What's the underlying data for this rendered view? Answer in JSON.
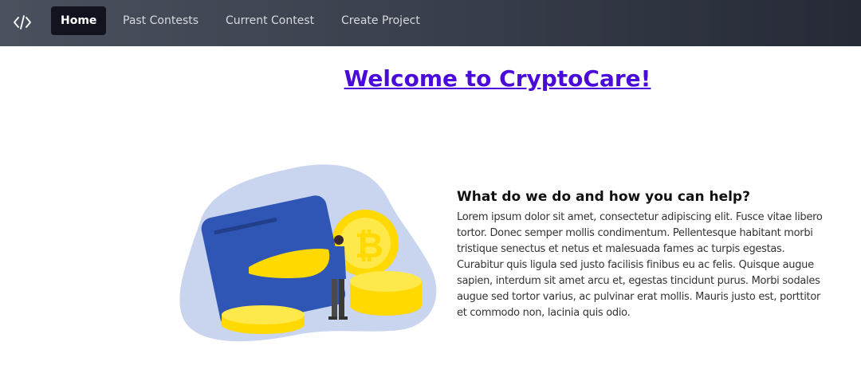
{
  "navbar": {
    "logo_icon": "code-icon",
    "items": [
      {
        "label": "Home",
        "active": true
      },
      {
        "label": "Past Contests",
        "active": false
      },
      {
        "label": "Current Contest",
        "active": false
      },
      {
        "label": "Create Project",
        "active": false
      }
    ]
  },
  "main": {
    "title": "Welcome to CryptoCare!",
    "section": {
      "heading": "What do we do and how you can help?",
      "body": "Lorem ipsum dolor sit amet, consectetur adipiscing elit. Fusce vitae libero tortor. Donec semper mollis condimentum. Pellentesque habitant morbi tristique senectus et netus et malesuada fames ac turpis egestas. Curabitur quis ligula sed justo facilisis finibus eu ac felis. Quisque augue sapien, interdum sit amet arcu et, egestas tincidunt purus. Morbi sodales augue sed tortor varius, ac pulvinar erat mollis. Mauris justo est, porttitor et commodo non, lacinia quis odio."
    },
    "illustration_icon": "crypto-wallet-illustration"
  },
  "colors": {
    "title_link": "#4a0ad8",
    "nav_active_bg": "#11131f",
    "wallet_blue": "#2f55b5",
    "coin_yellow": "#ffd900",
    "blob_bg": "#c9d4ee"
  }
}
